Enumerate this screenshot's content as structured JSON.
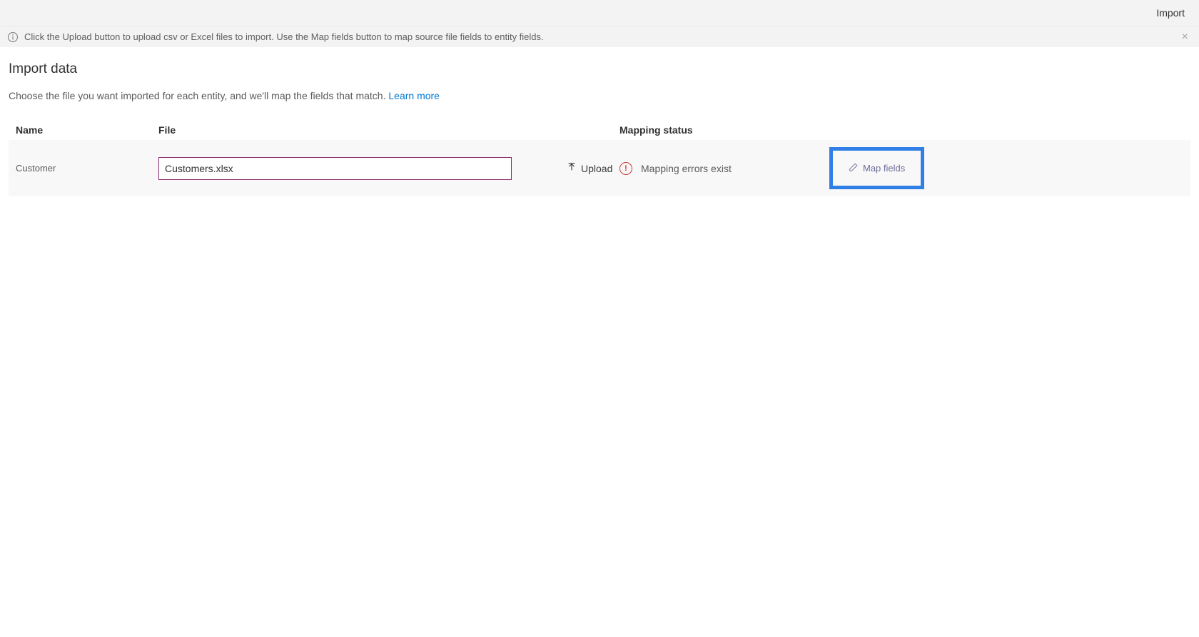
{
  "topbar": {
    "import_label": "Import"
  },
  "banner": {
    "text": "Click the Upload button to upload csv or Excel files to import. Use the Map fields button to map source file fields to entity fields."
  },
  "page": {
    "title": "Import data",
    "subtitle_prefix": "Choose the file you want imported for each entity, and we'll map the fields that match. ",
    "learn_more": "Learn more"
  },
  "columns": {
    "name": "Name",
    "file": "File",
    "status": "Mapping status"
  },
  "row": {
    "entity": "Customer",
    "filename": "Customers.xlsx",
    "upload_label": "Upload",
    "status_text": "Mapping errors exist",
    "map_fields_label": "Map fields"
  }
}
